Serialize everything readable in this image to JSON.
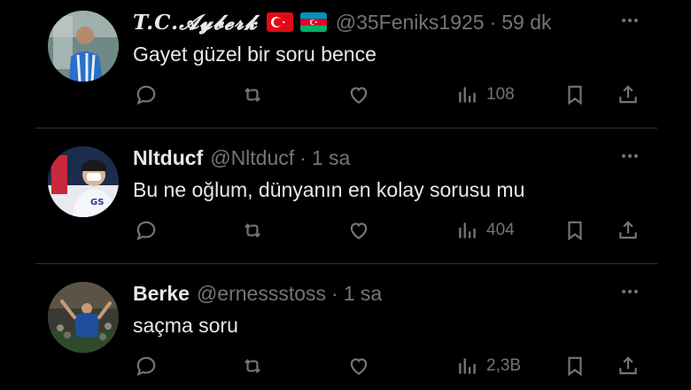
{
  "tweets": [
    {
      "name": "T.C.𝓐𝔂𝓫𝓮𝓻𝓴",
      "flags": [
        "turkey",
        "azerbaijan"
      ],
      "handle": "@35Feniks1925",
      "separator": "·",
      "time": "59 dk",
      "text": "Gayet güzel bir soru bence",
      "views": "108"
    },
    {
      "name": "Nltducf",
      "flags": [],
      "handle": "@Nltducf",
      "separator": "·",
      "time": "1 sa",
      "text": "Bu ne oğlum, dünyanın en kolay sorusu mu",
      "views": "404"
    },
    {
      "name": "Berke",
      "flags": [],
      "handle": "@ernessstoss",
      "separator": "·",
      "time": "1 sa",
      "text": "saçma soru",
      "views": "2,3B"
    }
  ],
  "icons": {
    "reply": "reply-icon",
    "retweet": "retweet-icon",
    "like": "heart-icon",
    "views": "views-icon",
    "bookmark": "bookmark-icon",
    "share": "share-icon",
    "more": "more-icon"
  },
  "colors": {
    "background": "#000000",
    "text": "#e7e9ea",
    "secondary": "#71767b",
    "divider": "#2f3336"
  }
}
